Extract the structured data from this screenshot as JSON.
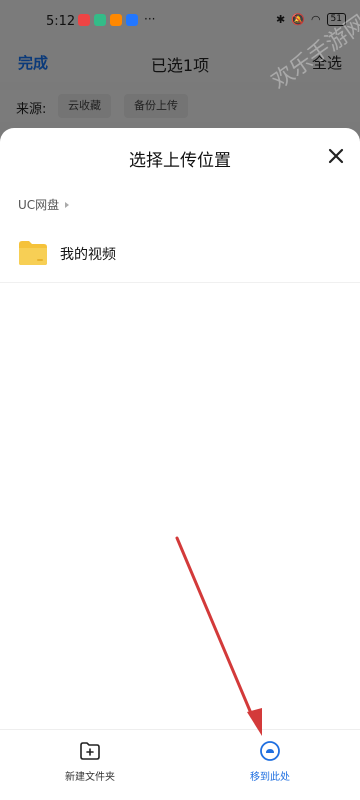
{
  "status_bar": {
    "time": "5:12",
    "battery": "51"
  },
  "top_bar": {
    "left": "完成",
    "title": "已选1项",
    "right": "全选"
  },
  "source": {
    "label": "来源:",
    "chips": [
      "云收藏",
      "备份上传"
    ]
  },
  "sheet": {
    "title": "选择上传位置",
    "breadcrumb": "UC网盘",
    "folders": [
      {
        "name": "我的视频"
      }
    ]
  },
  "bottom": {
    "new_folder": "新建文件夹",
    "move_here": "移到此处"
  },
  "watermark": "欢乐手游网",
  "colors": {
    "accent": "#1f6fe0",
    "folder": "#f5c23a",
    "arrow": "#d33a3a"
  }
}
